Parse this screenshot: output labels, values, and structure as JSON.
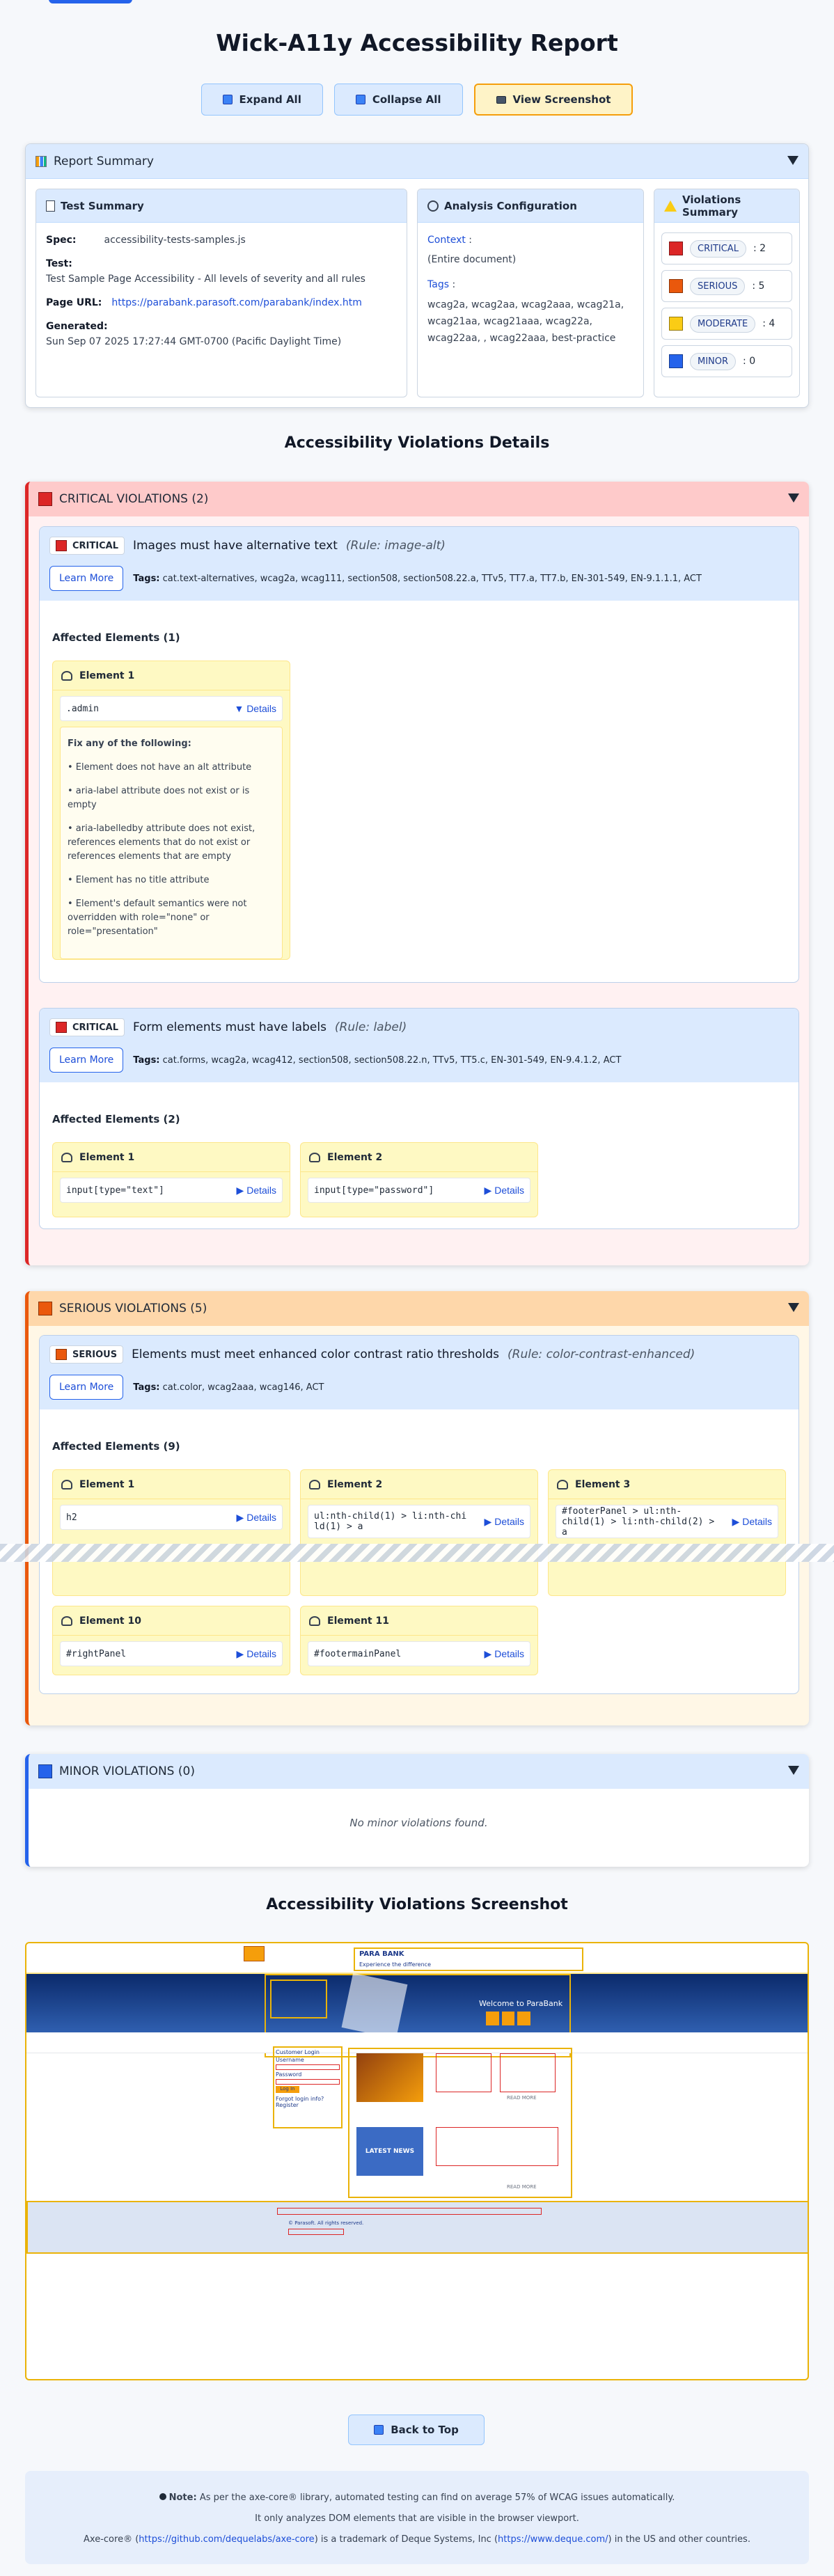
{
  "title": "Wick-A11y Accessibility Report",
  "actions": {
    "expand_all": "Expand All",
    "collapse_all": "Collapse All",
    "view_screenshot": "View Screenshot"
  },
  "summary": {
    "heading": "Report Summary",
    "test_summary": {
      "heading": "Test Summary",
      "spec_label": "Spec:",
      "spec": "accessibility-tests-samples.js",
      "test_label": "Test:",
      "test": "Test Sample Page Accessibility - All levels of severity and all rules",
      "url_label": "Page URL:",
      "url": "https://parabank.parasoft.com/parabank/index.htm",
      "generated_label": "Generated:",
      "generated": "Sun Sep 07 2025 17:27:44 GMT-0700 (Pacific Daylight Time)"
    },
    "analysis": {
      "heading": "Analysis Configuration",
      "context_label": "Context",
      "context": "(Entire document)",
      "tags_label": "Tags",
      "tags": "wcag2a, wcag2aa, wcag2aaa, wcag21a, wcag21aa, wcag21aaa, wcag22a, wcag22aa, , wcag22aaa, best-practice"
    },
    "violations": {
      "heading": "Violations Summary",
      "items": [
        {
          "label": "CRITICAL",
          "count": ": 2",
          "color": "#dc2626"
        },
        {
          "label": "SERIOUS",
          "count": ": 5",
          "color": "#ea580c"
        },
        {
          "label": "MODERATE",
          "count": ": 4",
          "color": "#facc15"
        },
        {
          "label": "MINOR",
          "count": ": 0",
          "color": "#2563eb"
        }
      ]
    }
  },
  "details_title": "Accessibility Violations Details",
  "critical": {
    "heading": "CRITICAL VIOLATIONS (2)",
    "rule1": {
      "badge": "CRITICAL",
      "name": "Images must have alternative text",
      "rule": "(Rule: image-alt)",
      "learn": "Learn More",
      "tags_label": "Tags:",
      "tags": "cat.text-alternatives, wcag2a, wcag111, section508, section508.22.a, TTv5, TT7.a, TT7.b, EN-301-549, EN-9.1.1.1, ACT",
      "affected": "Affected Elements (1)",
      "el1": {
        "title": "Element 1",
        "selector": ".admin",
        "details": "▼ Details",
        "fix_title": "Fix any of the following:",
        "fixes": [
          "• Element does not have an alt attribute",
          "• aria-label attribute does not exist or is empty",
          "• aria-labelledby attribute does not exist, references elements that do not exist or references elements that are empty",
          "• Element has no title attribute",
          "• Element's default semantics were not overridden with role=\"none\" or role=\"presentation\""
        ]
      }
    },
    "rule2": {
      "badge": "CRITICAL",
      "name": "Form elements must have labels",
      "rule": "(Rule: label)",
      "learn": "Learn More",
      "tags_label": "Tags:",
      "tags": "cat.forms, wcag2a, wcag412, section508, section508.22.n, TTv5, TT5.c, EN-301-549, EN-9.4.1.2, ACT",
      "affected": "Affected Elements (2)",
      "el1": {
        "title": "Element 1",
        "selector": "input[type=\"text\"]",
        "details": "▶ Details"
      },
      "el2": {
        "title": "Element 2",
        "selector": "input[type=\"password\"]",
        "details": "▶ Details"
      }
    }
  },
  "serious": {
    "heading": "SERIOUS VIOLATIONS (5)",
    "rule1": {
      "badge": "SERIOUS",
      "name": "Elements must meet enhanced color contrast ratio thresholds",
      "rule": "(Rule: color-contrast-enhanced)",
      "learn": "Learn More",
      "tags_label": "Tags:",
      "tags": "cat.color, wcag2aaa, wcag146, ACT",
      "affected": "Affected Elements (9)",
      "els": [
        {
          "title": "Element 1",
          "selector": "h2",
          "details": "▶ Details"
        },
        {
          "title": "Element 2",
          "selector": "ul:nth-child(1) > li:nth-child(1) > a",
          "details": "▶ Details"
        },
        {
          "title": "Element 3",
          "selector": "#footerPanel > ul:nth-child(1) > li:nth-child(2) > a",
          "details": "▶ Details"
        },
        {
          "title": "Element 10",
          "selector": "#rightPanel",
          "details": "▶ Details"
        },
        {
          "title": "Element 11",
          "selector": "#footermainPanel",
          "details": "▶ Details"
        }
      ]
    }
  },
  "minor": {
    "heading": "MINOR VIOLATIONS (0)",
    "empty": "No minor violations found."
  },
  "screenshot_title": "Accessibility Violations Screenshot",
  "shot": {
    "brand": "PARA BANK",
    "tagline": "Experience the difference",
    "welcome": "Welcome to ParaBank",
    "login": "Customer Login",
    "username": "Username",
    "password": "Password",
    "login_btn": "Log In",
    "forgot": "Forgot login info?",
    "register": "Register",
    "news": "LATEST NEWS",
    "read_more": "READ MORE",
    "copyright": "© Parasoft. All rights reserved."
  },
  "back_to_top": "Back to Top",
  "note": {
    "line1_bold": "Note:",
    "line1": "As per the axe-core® library, automated testing can find on average 57% of WCAG issues automatically.",
    "line2": "It only analyzes DOM elements that are visible in the browser viewport.",
    "line3_pre": "Axe-core® (",
    "line3_link1": "https://github.com/dequelabs/axe-core",
    "line3_mid": ") is a trademark of Deque Systems, Inc (",
    "line3_link2": "https://www.deque.com/",
    "line3_post": ") in the US and other countries."
  }
}
